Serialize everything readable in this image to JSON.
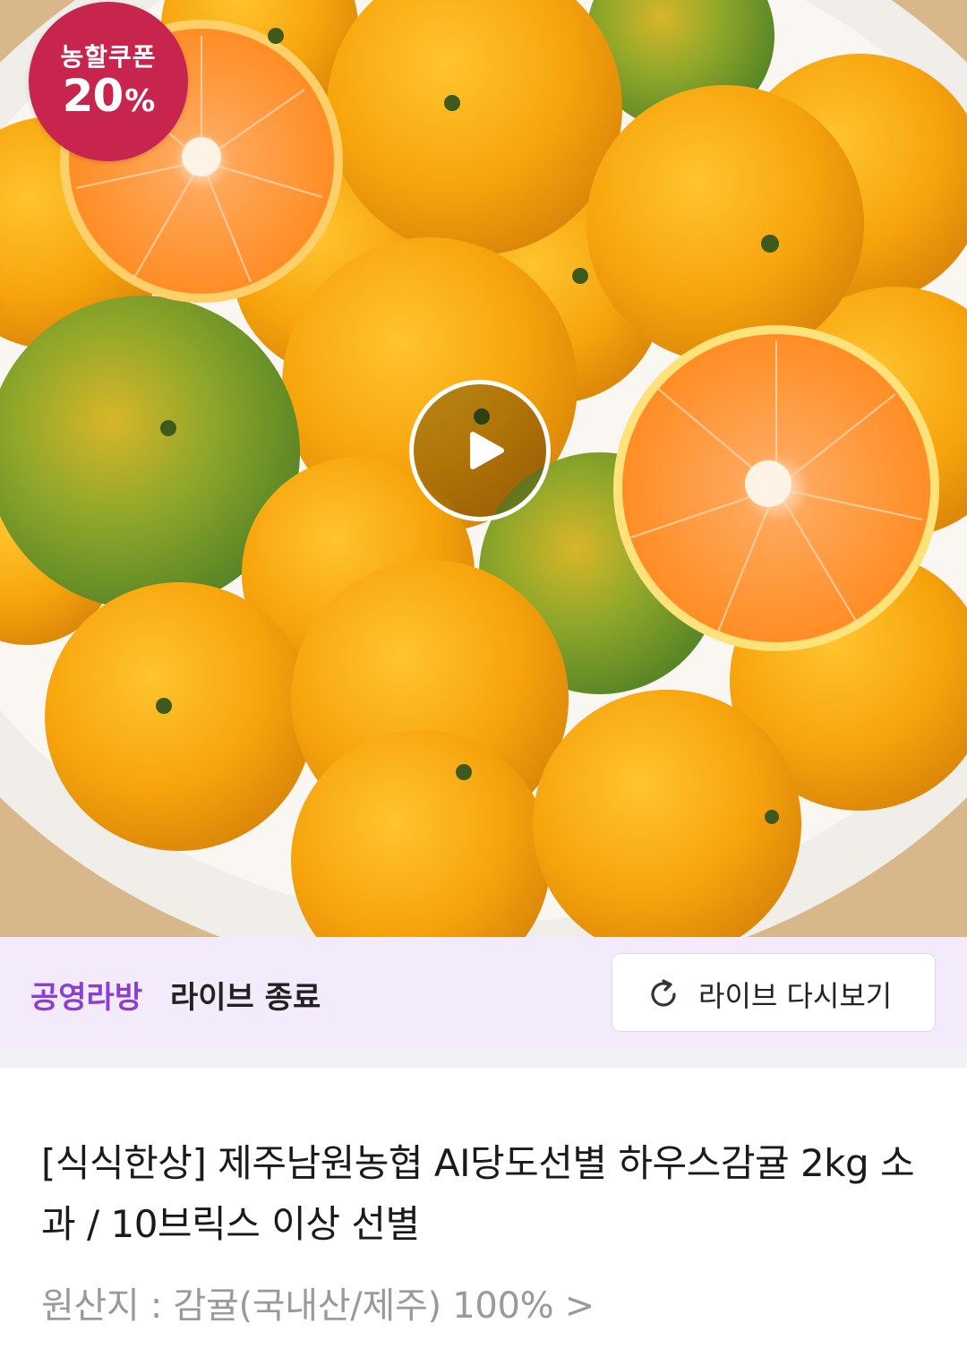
{
  "hero": {
    "image_subject": "tangerines-in-bowl",
    "coupon_badge": {
      "line1": "농할쿠폰",
      "value": "20",
      "unit": "%",
      "color": "#c8254e"
    },
    "play_icon": "play-icon"
  },
  "live": {
    "host": "공영라방",
    "status": "라이브 종료",
    "replay_label": "라이브 다시보기",
    "replay_icon": "refresh-icon",
    "host_color": "#8a3fd1",
    "bar_color": "#f3eafb"
  },
  "product": {
    "title": "[식식한상] 제주남원농협 AI당도선별 하우스감귤 2kg 소과 / 10브릭스 이상 선별",
    "origin": "원산지 : 감귤(국내산/제주) 100% >"
  }
}
